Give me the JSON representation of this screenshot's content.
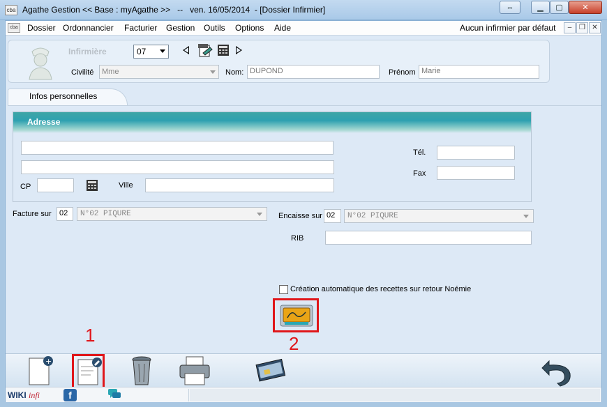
{
  "window": {
    "title": "Agathe Gestion << Base : myAgathe >>   --   ven. 16/05/2014  - [Dossier Infirmier]",
    "app_icon_text": "cba",
    "mdi_icon_text": "cba"
  },
  "menu": {
    "items": [
      "Dossier",
      "Ordonnancier",
      "Facturier",
      "Gestion",
      "Outils",
      "Options",
      "Aide"
    ],
    "status": "Aucun infirmier par défaut"
  },
  "nurse": {
    "label": "Infirmière",
    "number": "07",
    "civility_label": "Civilité",
    "civility_value": "Mme",
    "last_name_label": "Nom:",
    "last_name_value": "DUPOND",
    "first_name_label": "Prénom",
    "first_name_value": "Marie"
  },
  "tabs": [
    {
      "label": "Infos personnelles"
    }
  ],
  "address": {
    "title": "Adresse",
    "cp_label": "CP",
    "ville_label": "Ville",
    "tel_label": "Tél.",
    "fax_label": "Fax"
  },
  "billing": {
    "facture_label": "Facture sur",
    "facture_code": "02",
    "facture_value": "N°02 PIQURE",
    "encaisse_label": "Encaisse sur",
    "encaisse_code": "02",
    "encaisse_value": "N°02 PIQURE",
    "rib_label": "RIB"
  },
  "auto_recettes": {
    "label": "Création automatique des recettes sur retour Noémie",
    "checked": false
  },
  "annotations": {
    "one": "1",
    "two": "2"
  },
  "statusbar": {
    "wiki": "WIKI",
    "wiki_suffix": "infi",
    "fb": "f"
  },
  "colors": {
    "highlight": "#e0161a",
    "header_teal": "#2ea1b0",
    "window_frame": "#a9c7e2"
  }
}
